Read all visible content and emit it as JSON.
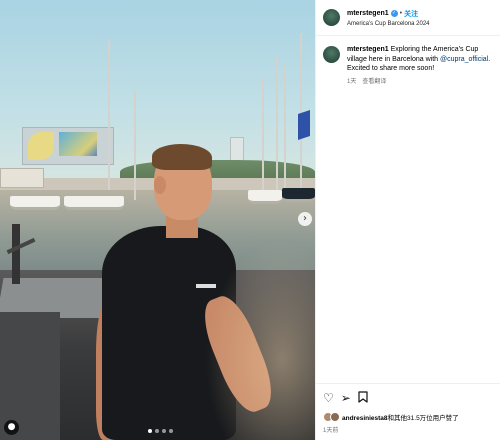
{
  "post": {
    "username": "mterstegen1",
    "verified_icon": "verified-badge-icon",
    "separator": "•",
    "follow_label": "关注",
    "location": "America's Cup Barcelona 2024"
  },
  "caption": {
    "username": "mterstegen1",
    "text_before": "Exploring the America's Cup village here in Barcelona with ",
    "mention": "@cupra_official",
    "text_after": ". Excited to share more soon!",
    "age": "1天",
    "translate_label": "查看翻译"
  },
  "actions": {
    "like_icon": "♡",
    "share_icon": "➢",
    "save_icon": "▯"
  },
  "likes": {
    "user": "andresiniesta8",
    "rest": "和其他31.5万位用户赞了"
  },
  "timestamp": "1天前",
  "carousel": {
    "next_icon": "›",
    "user_tag_icon": "●"
  }
}
